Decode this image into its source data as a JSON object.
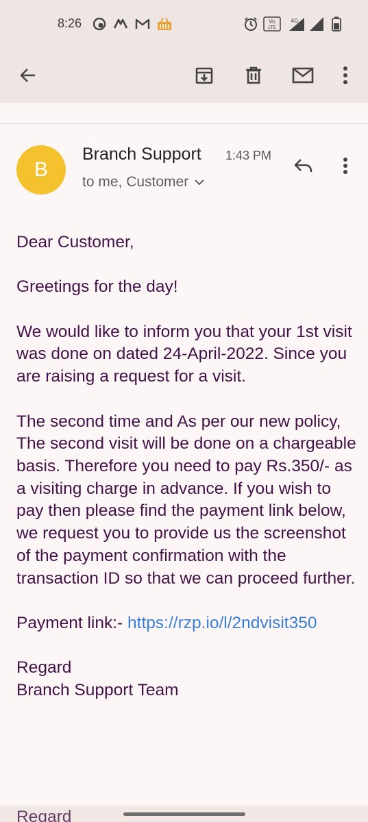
{
  "status_bar": {
    "time": "8:26",
    "icons": [
      "app-icon",
      "app-icon-2",
      "gmail-icon",
      "shopping-basket-icon",
      "alarm-icon",
      "volte-icon",
      "signal-4g-icon",
      "signal-icon",
      "battery-icon"
    ],
    "volte_label": "Vo LTE",
    "network_label": "4G"
  },
  "toolbar": {
    "actions": [
      "back",
      "archive",
      "delete",
      "mark-unread",
      "more-options"
    ]
  },
  "email": {
    "avatar_letter": "B",
    "sender": "Branch Support",
    "time": "1:43 PM",
    "recipients": "to me, Customer",
    "body": {
      "greeting": "Dear Customer,",
      "line2": "Greetings for the day!",
      "para1": "We would like to inform you that your 1st visit was done on dated 24-April-2022. Since you are raising a request for a visit.",
      "para2": "The second time and As per our new policy, The second visit will be done on a chargeable basis. Therefore you need to pay Rs.350/- as a visiting charge in advance. If you wish to pay then please find the payment link below, we request you to provide us the screenshot of the payment confirmation with the transaction ID so that we can proceed further.",
      "payment_label": "Payment link:- ",
      "payment_url": "https://rzp.io/l/2ndvisit350",
      "sign1": "Regard",
      "sign2": "Branch Support Team",
      "cutoff": "Regard"
    }
  },
  "colors": {
    "background": "#fcf7f6",
    "toolbar": "#efe5e3",
    "body_text": "#431247",
    "link": "#3b7ed6",
    "avatar": "#f4c22f"
  }
}
